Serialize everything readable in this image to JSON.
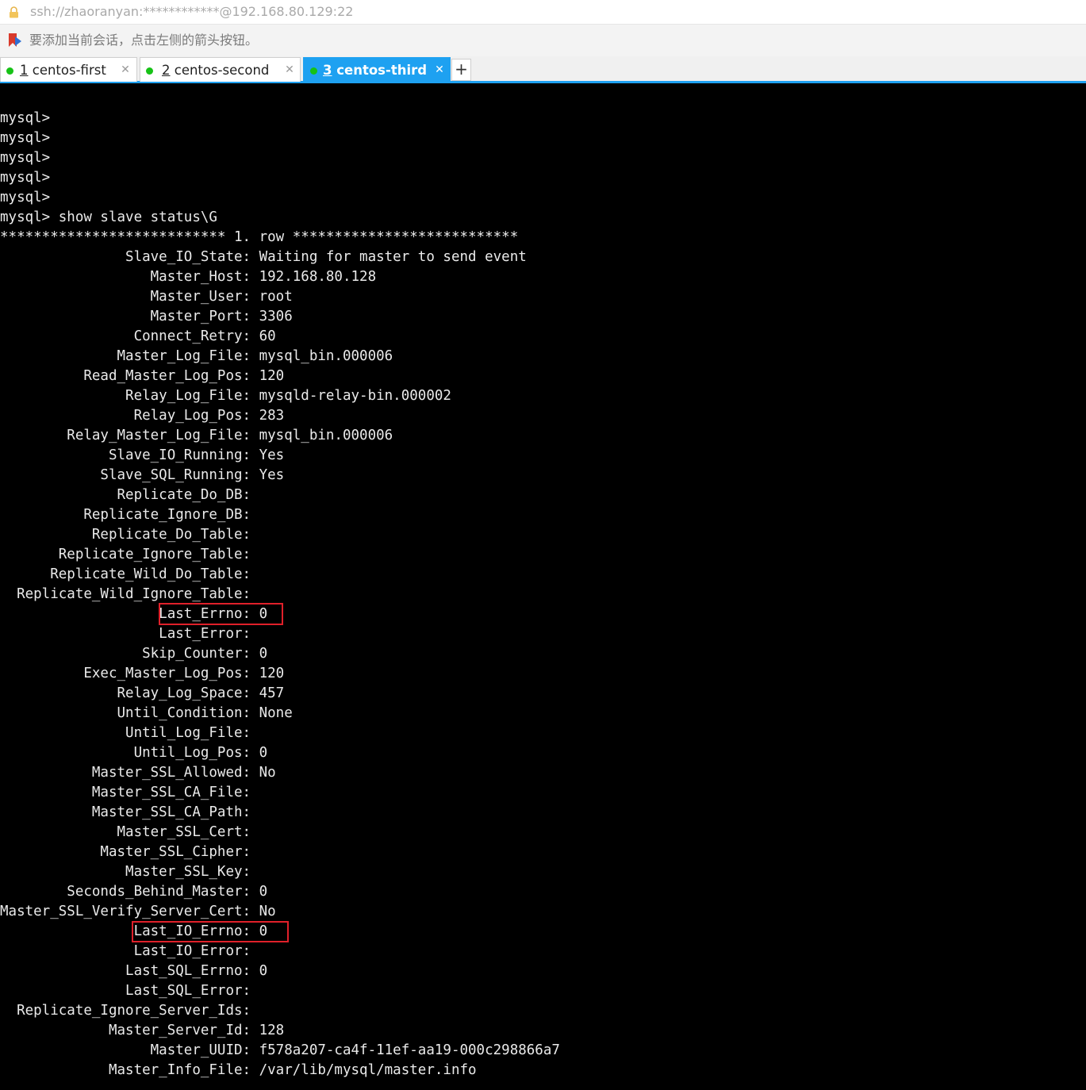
{
  "address_bar": {
    "url": "ssh://zhaoranyan:************@192.168.80.129:22"
  },
  "hint_bar": {
    "text": "要添加当前会话，点击左侧的箭头按钮。"
  },
  "tabs": [
    {
      "num": "1",
      "name": "centos-first",
      "active": false
    },
    {
      "num": "2",
      "name": "centos-second",
      "active": false
    },
    {
      "num": "3",
      "name": "centos-third",
      "active": true
    }
  ],
  "tab_close_glyph": "✕",
  "tab_add_glyph": "+",
  "colors": {
    "tab_active": "#1ea1f1",
    "status_dot": "#16c216",
    "highlight_box": "#e0202a",
    "terminal_bg": "#000000",
    "terminal_fg": "#eaeaea"
  },
  "terminal": {
    "lines": [
      "mysql>",
      "mysql>",
      "mysql>",
      "mysql>",
      "mysql>",
      "mysql> show slave status\\G",
      "*************************** 1. row ***************************",
      "               Slave_IO_State: Waiting for master to send event",
      "                  Master_Host: 192.168.80.128",
      "                  Master_User: root",
      "                  Master_Port: 3306",
      "                Connect_Retry: 60",
      "              Master_Log_File: mysql_bin.000006",
      "          Read_Master_Log_Pos: 120",
      "               Relay_Log_File: mysqld-relay-bin.000002",
      "                Relay_Log_Pos: 283",
      "        Relay_Master_Log_File: mysql_bin.000006",
      "             Slave_IO_Running: Yes",
      "            Slave_SQL_Running: Yes",
      "              Replicate_Do_DB:",
      "          Replicate_Ignore_DB:",
      "           Replicate_Do_Table:",
      "       Replicate_Ignore_Table:",
      "      Replicate_Wild_Do_Table:",
      "  Replicate_Wild_Ignore_Table:",
      "                   Last_Errno: 0",
      "                   Last_Error:",
      "                 Skip_Counter: 0",
      "          Exec_Master_Log_Pos: 120",
      "              Relay_Log_Space: 457",
      "              Until_Condition: None",
      "               Until_Log_File:",
      "                Until_Log_Pos: 0",
      "           Master_SSL_Allowed: No",
      "           Master_SSL_CA_File:",
      "           Master_SSL_CA_Path:",
      "              Master_SSL_Cert:",
      "            Master_SSL_Cipher:",
      "               Master_SSL_Key:",
      "        Seconds_Behind_Master: 0",
      "Master_SSL_Verify_Server_Cert: No",
      "                Last_IO_Errno: 0",
      "                Last_IO_Error:",
      "               Last_SQL_Errno: 0",
      "               Last_SQL_Error:",
      "  Replicate_Ignore_Server_Ids:",
      "             Master_Server_Id: 128",
      "                  Master_UUID: f578a207-ca4f-11ef-aa19-000c298866a7",
      "             Master_Info_File: /var/lib/mysql/master.info"
    ]
  }
}
